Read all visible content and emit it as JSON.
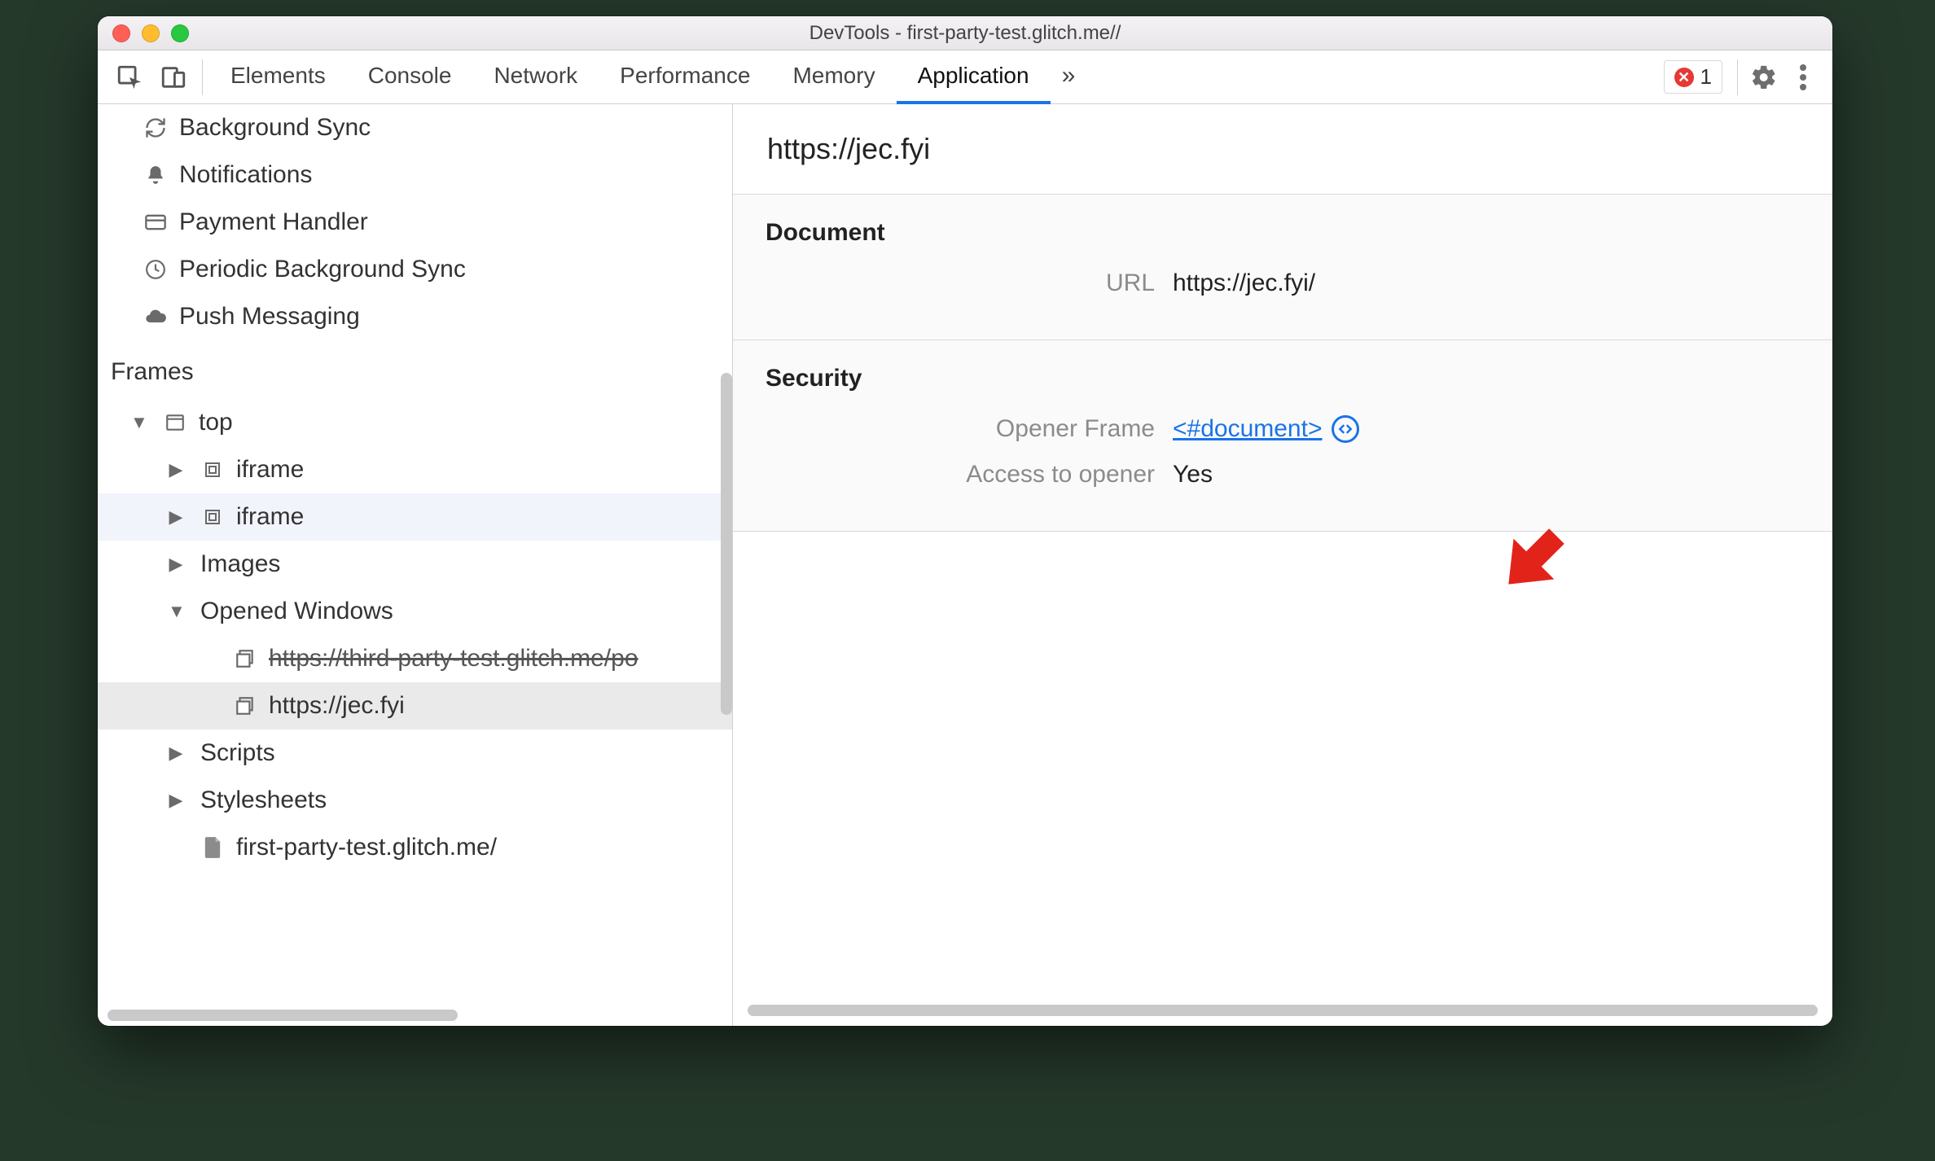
{
  "window": {
    "title": "DevTools - first-party-test.glitch.me//"
  },
  "toolbar": {
    "tabs": [
      "Elements",
      "Console",
      "Network",
      "Performance",
      "Memory",
      "Application"
    ],
    "active_tab": "Application",
    "overflow": "»",
    "error_count": "1"
  },
  "sidebar": {
    "bg_items": [
      {
        "label": "Background Sync",
        "icon": "sync"
      },
      {
        "label": "Notifications",
        "icon": "bell"
      },
      {
        "label": "Payment Handler",
        "icon": "card"
      },
      {
        "label": "Periodic Background Sync",
        "icon": "clock"
      },
      {
        "label": "Push Messaging",
        "icon": "cloud"
      }
    ],
    "section_frames": "Frames",
    "tree": {
      "top": "top",
      "iframe1": "iframe",
      "iframe2": "iframe",
      "images": "Images",
      "opened_windows": "Opened Windows",
      "ow1": "https://third-party-test.glitch.me/po",
      "ow2": "https://jec.fyi",
      "scripts": "Scripts",
      "stylesheets": "Stylesheets",
      "doc": "first-party-test.glitch.me/"
    }
  },
  "main": {
    "title": "https://jec.fyi",
    "section_document": "Document",
    "url_label": "URL",
    "url_value": "https://jec.fyi/",
    "section_security": "Security",
    "opener_frame_label": "Opener Frame",
    "opener_frame_value": "<#document>",
    "access_label": "Access to opener",
    "access_value": "Yes"
  }
}
